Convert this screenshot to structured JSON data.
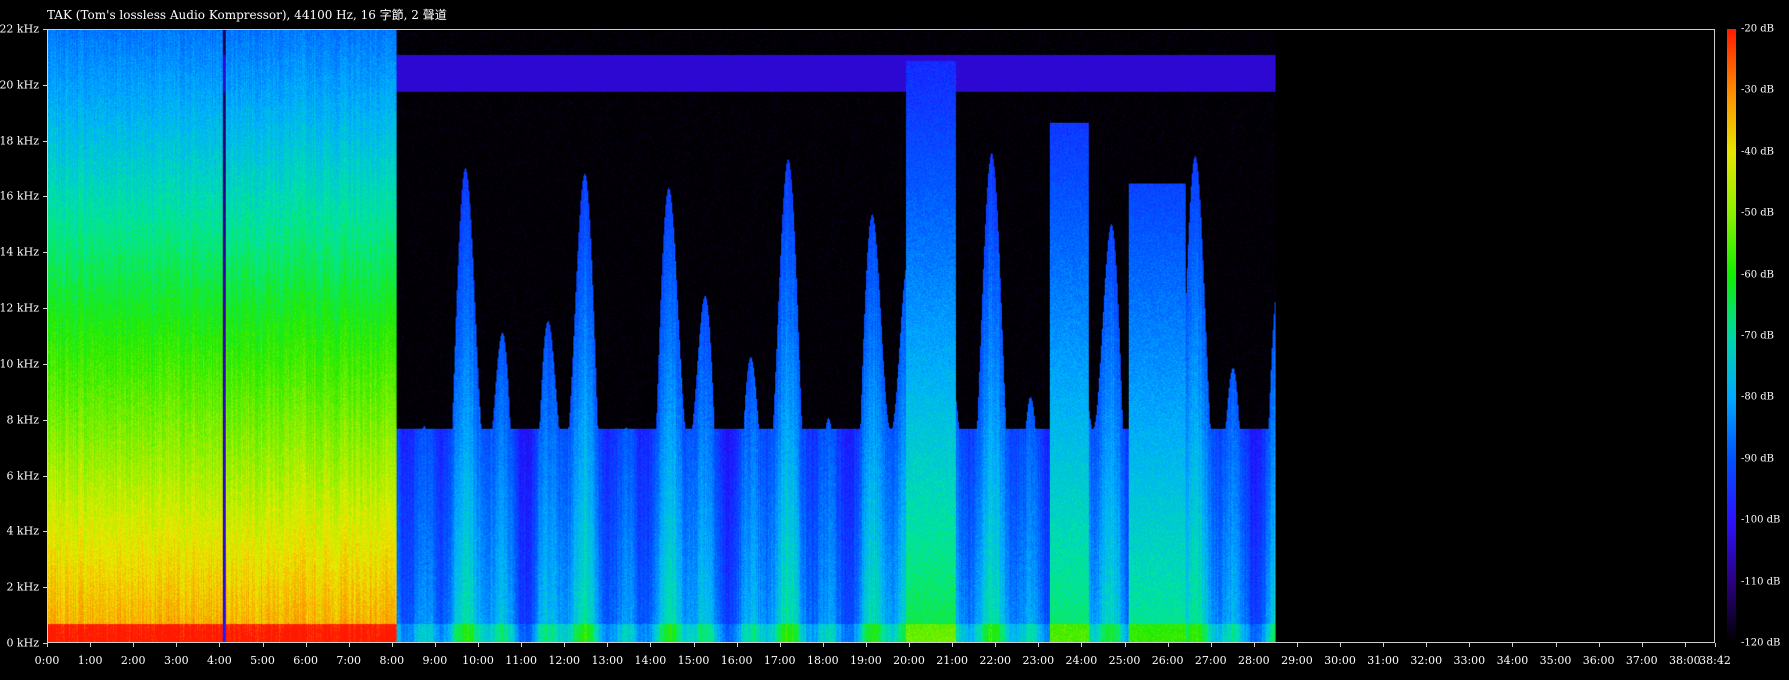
{
  "title": "TAK (Tom's lossless Audio Kompressor), 44100 Hz, 16 字節, 2 聲道",
  "chart_data": {
    "type": "heatmap",
    "title": "TAK (Tom's lossless Audio Kompressor), 44100 Hz, 16 字節, 2 聲道",
    "x_range_seconds": [
      0,
      2322
    ],
    "y_range_khz": [
      0,
      22
    ],
    "color_range_db": [
      -120,
      -20
    ],
    "grid": false,
    "legend": "right colorbar",
    "y_ticks": [
      "22 kHz",
      "20 kHz",
      "18 kHz",
      "16 kHz",
      "14 kHz",
      "12 kHz",
      "10 kHz",
      "8 kHz",
      "6 kHz",
      "4 kHz",
      "2 kHz",
      "0 kHz"
    ],
    "x_ticks": [
      "0:00",
      "1:00",
      "2:00",
      "3:00",
      "4:00",
      "5:00",
      "6:00",
      "7:00",
      "8:00",
      "9:00",
      "10:00",
      "11:00",
      "12:00",
      "13:00",
      "14:00",
      "15:00",
      "16:00",
      "17:00",
      "18:00",
      "19:00",
      "20:00",
      "21:00",
      "22:00",
      "23:00",
      "24:00",
      "25:00",
      "26:00",
      "27:00",
      "28:00",
      "29:00",
      "30:00",
      "31:00",
      "32:00",
      "33:00",
      "34:00",
      "35:00",
      "36:00",
      "37:00",
      "38:00",
      "38:42"
    ],
    "colorbar_ticks": [
      "-20 dB",
      "-30 dB",
      "-40 dB",
      "-50 dB",
      "-60 dB",
      "-70 dB",
      "-80 dB",
      "-90 dB",
      "-100 dB",
      "-110 dB",
      "-120 dB"
    ],
    "segments": [
      {
        "start": "0:00",
        "end": "4:05",
        "bandwidth_khz": 22,
        "level": "high"
      },
      {
        "start": "4:05",
        "end": "8:05",
        "bandwidth_khz": 22,
        "level": "high"
      },
      {
        "start": "8:05",
        "end": "28:30",
        "bandwidth_khz": 21,
        "level": "low"
      },
      {
        "start": "28:30",
        "end": "38:42",
        "bandwidth_khz": 0,
        "level": "silence"
      }
    ]
  }
}
